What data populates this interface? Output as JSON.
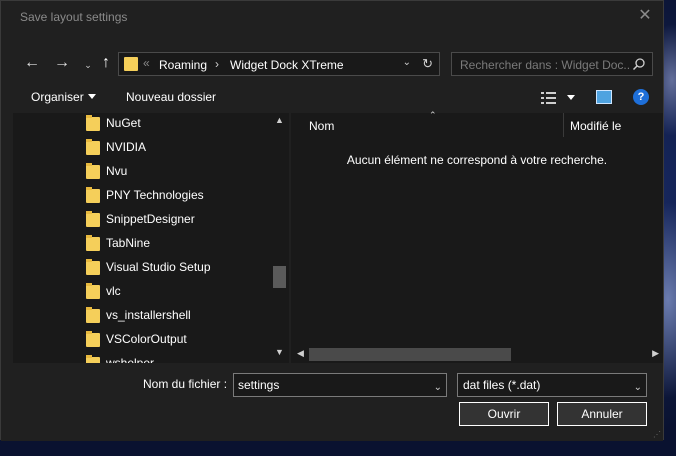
{
  "window": {
    "title": "Save layout settings",
    "close_icon": "close-icon"
  },
  "nav": {
    "back_icon": "arrow-left-icon",
    "forward_icon": "arrow-right-icon",
    "recent_icon": "chevron-down-icon",
    "up_icon": "arrow-up-icon",
    "address": {
      "overflow": "«",
      "crumbs": [
        "Roaming",
        "Widget Dock XTreme"
      ],
      "separator": "›"
    },
    "search_placeholder": "Rechercher dans : Widget Doc..."
  },
  "toolbar": {
    "organiser": "Organiser",
    "new_folder": "Nouveau dossier",
    "help": "?"
  },
  "tree": {
    "items": [
      "NuGet",
      "NVIDIA",
      "Nvu",
      "PNY Technologies",
      "SnippetDesigner",
      "TabNine",
      "Visual Studio Setup",
      "vlc",
      "vs_installershell",
      "VSColorOutput",
      "wshelper"
    ]
  },
  "content": {
    "columns": [
      "Nom",
      "Modifié le"
    ],
    "empty_message": "Aucun élément ne correspond à votre recherche."
  },
  "footer": {
    "filename_label": "Nom du fichier :",
    "filename_value": "settings",
    "filetype_value": "dat files (*.dat)",
    "open_button": "Ouvrir",
    "cancel_button": "Annuler"
  }
}
